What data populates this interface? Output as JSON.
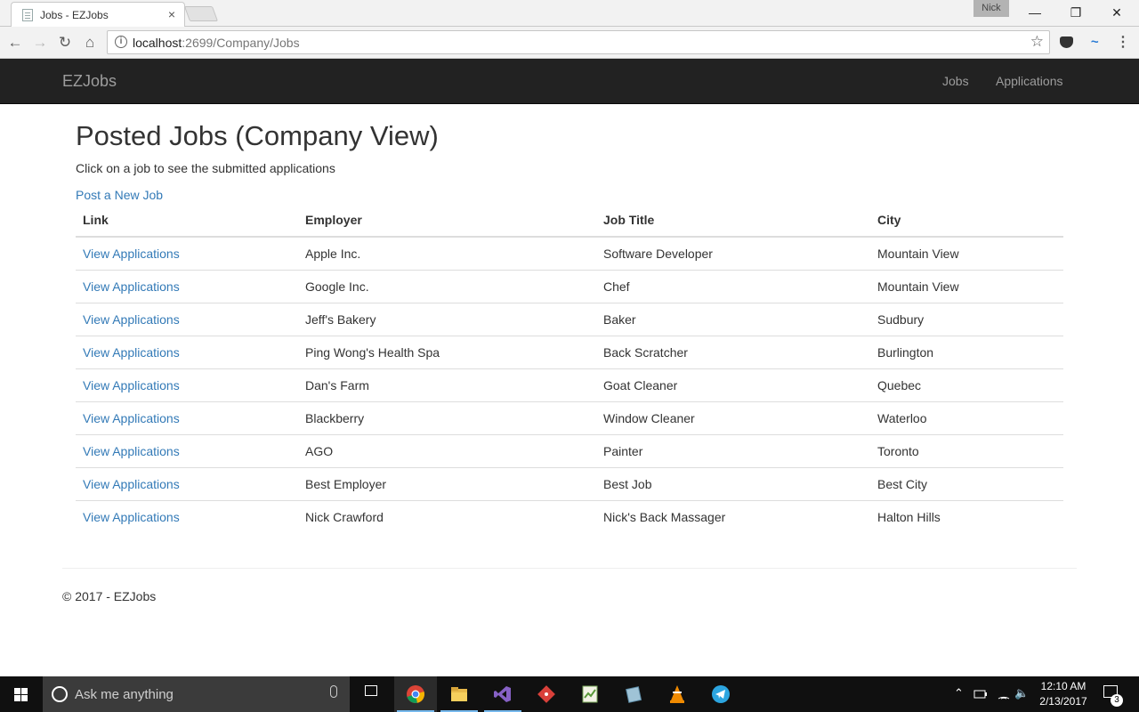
{
  "browser": {
    "tab_title": "Jobs - EZJobs",
    "tab_close": "×",
    "profile_name": "Nick",
    "url_host": "localhost",
    "url_path": ":2699/Company/Jobs",
    "window_controls": {
      "minimize": "—",
      "restore": "❐",
      "close": "✕"
    },
    "nav": {
      "back": "←",
      "forward": "→",
      "reload": "↻",
      "home": "⌂"
    },
    "bookmark_star": "☆",
    "menu_dots": "⋮",
    "ext_wave": "~"
  },
  "app": {
    "brand": "EZJobs",
    "nav_links": [
      "Jobs",
      "Applications"
    ]
  },
  "page": {
    "title": "Posted Jobs (Company View)",
    "subtitle": "Click on a job to see the submitted applications",
    "new_job_link": "Post a New Job",
    "columns": [
      "Link",
      "Employer",
      "Job Title",
      "City"
    ],
    "rows": [
      {
        "link": "View Applications",
        "employer": "Apple Inc.",
        "title": "Software Developer",
        "city": "Mountain View"
      },
      {
        "link": "View Applications",
        "employer": "Google Inc.",
        "title": "Chef",
        "city": "Mountain View"
      },
      {
        "link": "View Applications",
        "employer": "Jeff's Bakery",
        "title": "Baker",
        "city": "Sudbury"
      },
      {
        "link": "View Applications",
        "employer": "Ping Wong's Health Spa",
        "title": "Back Scratcher",
        "city": "Burlington"
      },
      {
        "link": "View Applications",
        "employer": "Dan's Farm",
        "title": "Goat Cleaner",
        "city": "Quebec"
      },
      {
        "link": "View Applications",
        "employer": "Blackberry",
        "title": "Window Cleaner",
        "city": "Waterloo"
      },
      {
        "link": "View Applications",
        "employer": "AGO",
        "title": "Painter",
        "city": "Toronto"
      },
      {
        "link": "View Applications",
        "employer": "Best Employer",
        "title": "Best Job",
        "city": "Best City"
      },
      {
        "link": "View Applications",
        "employer": "Nick Crawford",
        "title": "Nick's Back Massager",
        "city": "Halton Hills"
      }
    ],
    "footer": "© 2017 - EZJobs"
  },
  "taskbar": {
    "search_placeholder": "Ask me anything",
    "time": "12:10 AM",
    "date": "2/13/2017",
    "notification_count": "3",
    "tray_chevron": "⌃",
    "tray_volume": "🔈"
  },
  "colors": {
    "navbar_bg": "#222222",
    "link": "#337ab7",
    "taskbar_bg": "#101010"
  }
}
